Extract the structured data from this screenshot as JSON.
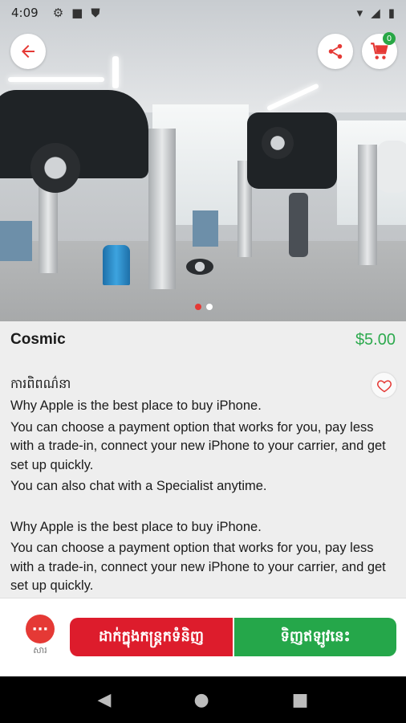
{
  "status_bar": {
    "time": "4:09",
    "icons": [
      "gear-icon",
      "square-icon",
      "shield-icon"
    ],
    "right_icons": [
      "wifi-icon",
      "signal-icon",
      "battery-icon"
    ]
  },
  "header": {
    "back_icon": "arrow-left-icon",
    "share_icon": "share-icon",
    "cart_icon": "cart-icon",
    "cart_count": "0"
  },
  "carousel": {
    "active_index": 0,
    "total": 2
  },
  "product": {
    "name": "Cosmic",
    "price": "$5.00",
    "description_heading": "ការពិពណ៌នា",
    "description": [
      "Why Apple is the best place to buy iPhone.",
      "You can choose a payment option that works for you, pay less with a trade-in, connect your new iPhone to your carrier, and get set up quickly.",
      "You can also chat with a Specialist anytime.",
      "",
      "Why Apple is the best place to buy iPhone.",
      "You can choose a payment option that works for you, pay less with a trade-in, connect your new iPhone to your carrier, and get set up quickly."
    ]
  },
  "actions": {
    "chat_label": "សារ",
    "add_to_cart_label": "ដាក់ក្នុងកន្ត្រកទំនិញ",
    "buy_now_label": "ទិញឥឡូវនេះ"
  },
  "colors": {
    "accent_red": "#dd1c2c",
    "accent_green": "#25a74a",
    "price_green": "#2eaa4f"
  }
}
